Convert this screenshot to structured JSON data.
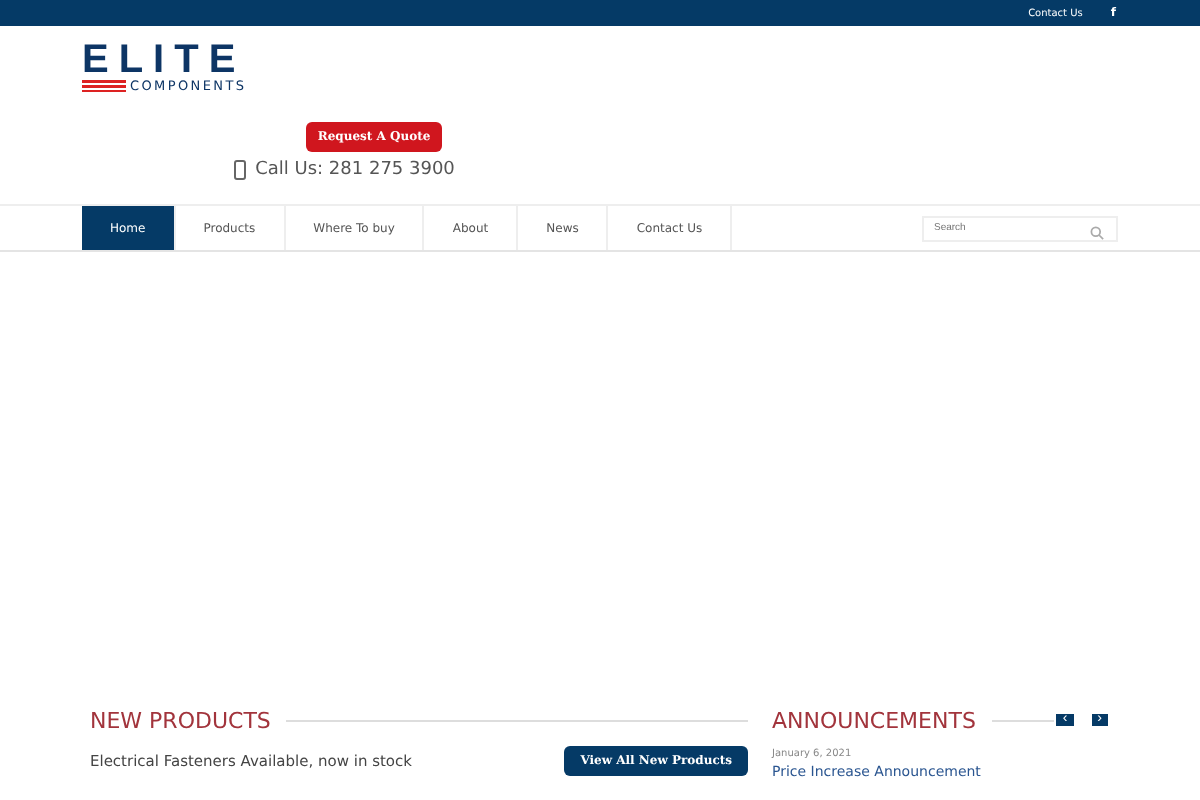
{
  "top_bar": {
    "links": [
      "Contact Us",
      "f"
    ]
  },
  "logo": {
    "title": "ELITE",
    "subtitle": "COMPONENTS"
  },
  "quote_button": "Request A Quote",
  "phone": "Call Us: 281 275 3900",
  "nav": {
    "items": [
      {
        "label": "Home",
        "selected": true
      },
      {
        "label": "Products",
        "selected": false
      },
      {
        "label": "Where To buy",
        "selected": false
      },
      {
        "label": "About",
        "selected": false
      },
      {
        "label": "News",
        "selected": false
      },
      {
        "label": "Contact Us",
        "selected": false
      }
    ],
    "search": {
      "placeholder": "Search"
    }
  },
  "new_products": {
    "title": "NEW PRODUCTS",
    "item": "Electrical Fasteners Available, now in stock",
    "button": "View All New Products"
  },
  "announcements": {
    "title": "ANNOUNCEMENTS",
    "prev": "‹",
    "next": "›",
    "date": "January 6, 2021",
    "headline": "Price Increase Announcement"
  }
}
